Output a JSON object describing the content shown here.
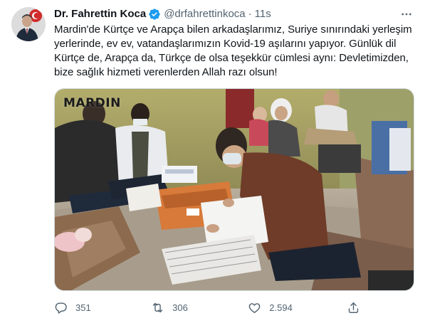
{
  "author": {
    "name": "Dr. Fahrettin Koca",
    "handle": "@drfahrettinkoca",
    "separator": "·",
    "time": "11s",
    "verified_color": "#1d9bf0"
  },
  "tweet": {
    "text": "Mardin'de Kürtçe ve Arapça bilen arkadaşlarımız, Suriye sınırındaki yerleşim yerlerinde, ev ev, vatandaşlarımızın Kovid-19 aşılarını yapıyor. Günlük dil Kürtçe de, Arapça da, Türkçe de olsa teşekkür cümlesi aynı: Devletimizden, bize sağlık hizmeti verenlerden Allah razı olsun!"
  },
  "media": {
    "watermark": "MARDIN"
  },
  "actions": {
    "reply": {
      "icon": "reply-icon",
      "count": "351"
    },
    "retweet": {
      "icon": "retweet-icon",
      "count": "306"
    },
    "like": {
      "icon": "like-icon",
      "count": "2.594"
    },
    "share": {
      "icon": "share-icon"
    }
  },
  "colors": {
    "text": "#0f1419",
    "secondary": "#536471",
    "border": "#cfd9de"
  }
}
